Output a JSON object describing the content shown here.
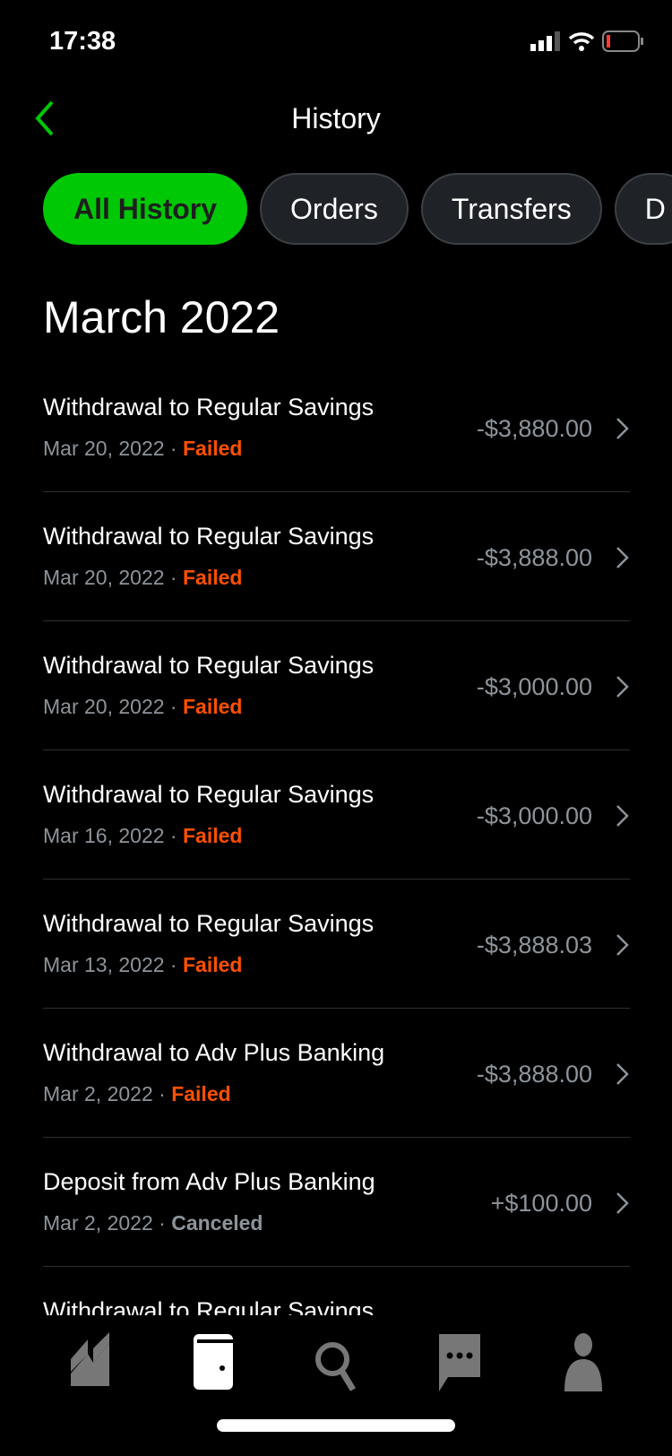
{
  "status": {
    "time": "17:38",
    "battery_color": "#ff3b30"
  },
  "header": {
    "title": "History",
    "accent": "#00c805"
  },
  "filters": [
    {
      "label": "All History",
      "active": true
    },
    {
      "label": "Orders"
    },
    {
      "label": "Transfers"
    },
    {
      "label": "D"
    }
  ],
  "section": {
    "title": "March 2022"
  },
  "items": [
    {
      "title": "Withdrawal to Regular Savings",
      "date": "Mar 20, 2022",
      "status": "Failed",
      "amount": "-$3,880.00"
    },
    {
      "title": "Withdrawal to Regular Savings",
      "date": "Mar 20, 2022",
      "status": "Failed",
      "amount": "-$3,888.00"
    },
    {
      "title": "Withdrawal to Regular Savings",
      "date": "Mar 20, 2022",
      "status": "Failed",
      "amount": "-$3,000.00"
    },
    {
      "title": "Withdrawal to Regular Savings",
      "date": "Mar 16, 2022",
      "status": "Failed",
      "amount": "-$3,000.00"
    },
    {
      "title": "Withdrawal to Regular Savings",
      "date": "Mar 13, 2022",
      "status": "Failed",
      "amount": "-$3,888.03"
    },
    {
      "title": "Withdrawal to Adv Plus Banking",
      "date": "Mar 2, 2022",
      "status": "Failed",
      "amount": "-$3,888.00"
    },
    {
      "title": "Deposit from Adv Plus Banking",
      "date": "Mar 2, 2022",
      "status": "Canceled",
      "amount": "+$100.00"
    },
    {
      "title": "Withdrawal to Regular Savings",
      "date": "",
      "status": "",
      "amount": ""
    }
  ],
  "separator": " · ",
  "tabbar": [
    {
      "icon": "chart-icon"
    },
    {
      "icon": "wallet-icon",
      "active": true
    },
    {
      "icon": "search-icon"
    },
    {
      "icon": "chat-icon"
    },
    {
      "icon": "profile-icon"
    }
  ]
}
